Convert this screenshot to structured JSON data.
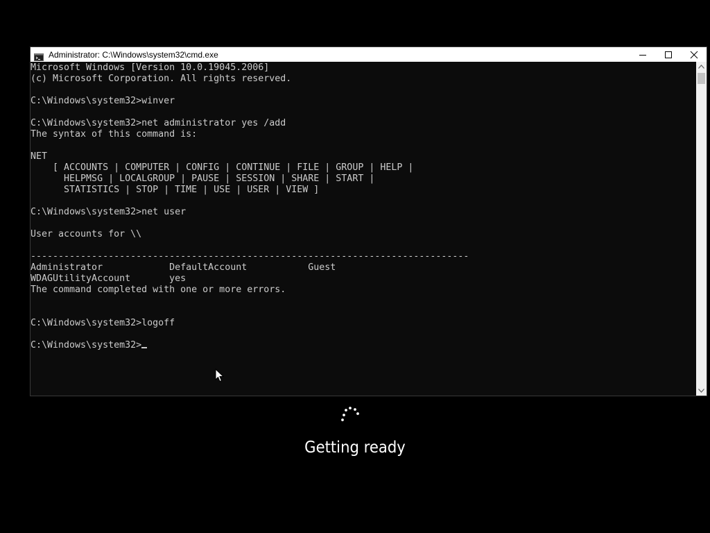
{
  "window": {
    "title": "Administrator: C:\\Windows\\system32\\cmd.exe",
    "icon": "cmd-icon",
    "controls": [
      "minimize-icon",
      "maximize-icon",
      "close-icon"
    ]
  },
  "console": {
    "lines": [
      "Microsoft Windows [Version 10.0.19045.2006]",
      "(c) Microsoft Corporation. All rights reserved.",
      "",
      "C:\\Windows\\system32>winver",
      "",
      "C:\\Windows\\system32>net administrator yes /add",
      "The syntax of this command is:",
      "",
      "NET",
      "    [ ACCOUNTS | COMPUTER | CONFIG | CONTINUE | FILE | GROUP | HELP |",
      "      HELPMSG | LOCALGROUP | PAUSE | SESSION | SHARE | START |",
      "      STATISTICS | STOP | TIME | USE | USER | VIEW ]",
      "",
      "C:\\Windows\\system32>net user",
      "",
      "User accounts for \\\\",
      "",
      "-------------------------------------------------------------------------------",
      "Administrator            DefaultAccount           Guest",
      "WDAGUtilityAccount       yes",
      "The command completed with one or more errors.",
      "",
      "",
      "C:\\Windows\\system32>logoff",
      ""
    ],
    "prompt": "C:\\Windows\\system32>"
  },
  "status": {
    "text": "Getting ready",
    "icon": "loading-spinner-icon"
  },
  "colors": {
    "console_bg": "#0c0c0c",
    "console_fg": "#cccccc",
    "desktop_bg": "#000000",
    "titlebar_bg": "#ffffff"
  }
}
